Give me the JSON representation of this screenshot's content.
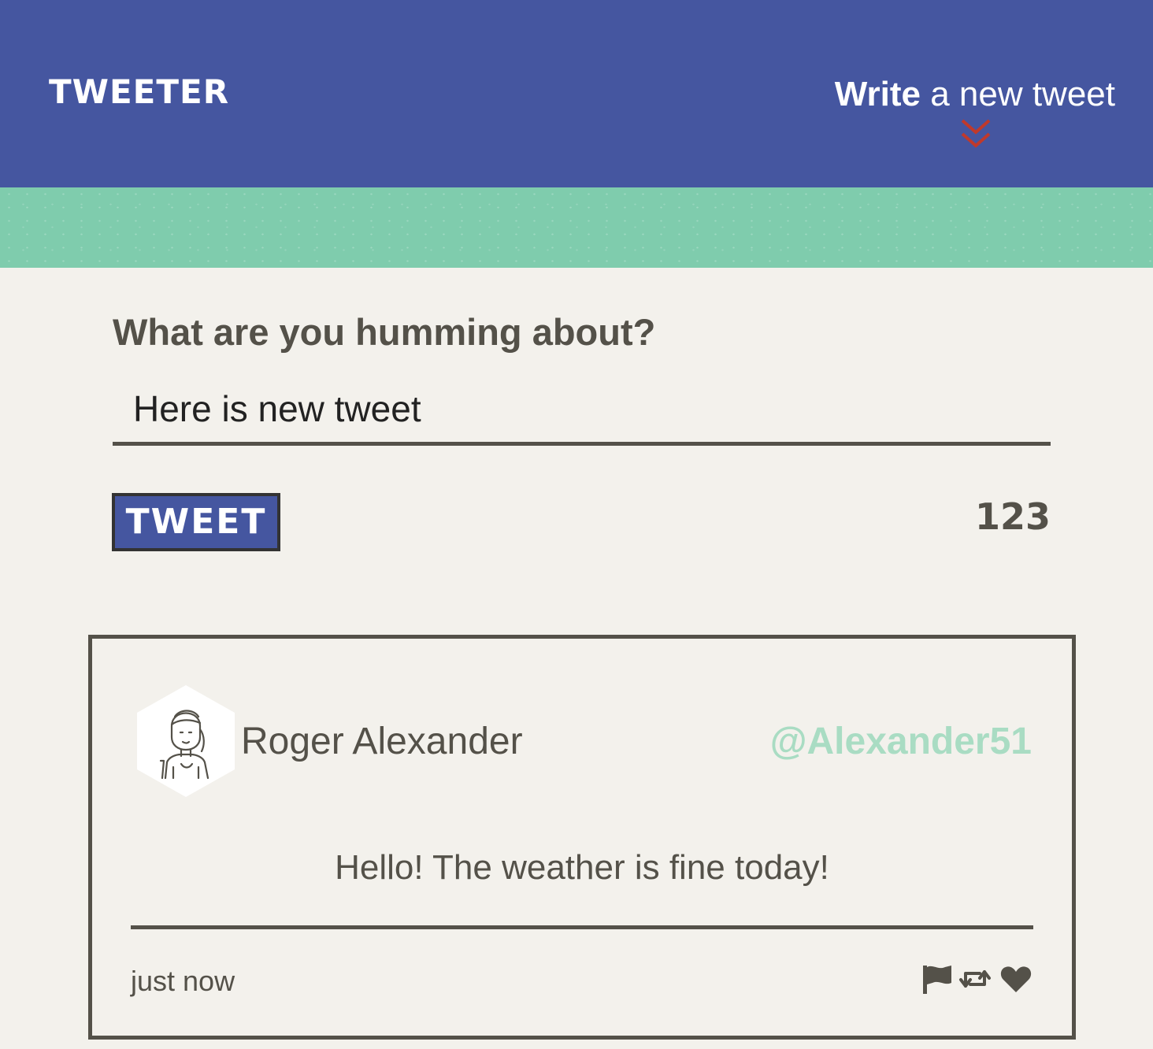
{
  "nav": {
    "brand": "TWEETER",
    "compose_bold": "Write",
    "compose_rest": " a new tweet",
    "chevron_icon": "double-chevron-down-icon"
  },
  "compose": {
    "heading": "What are you humming about?",
    "input_value": "Here is new tweet",
    "tweet_button": "TWEET",
    "char_counter": "123"
  },
  "tweets": [
    {
      "avatar_icon": "person-avatar-icon",
      "name": "Roger Alexander",
      "handle": "@Alexander51",
      "body": "Hello! The weather is fine today!",
      "timestamp": "just now",
      "actions": [
        "flag-icon",
        "retweet-icon",
        "heart-icon"
      ]
    }
  ],
  "colors": {
    "nav_bg": "#4556a0",
    "banner_bg": "#7fccad",
    "page_bg": "#f3f1ec",
    "text": "#545149",
    "handle": "#a9dcc3",
    "chevron": "#c0392b"
  }
}
